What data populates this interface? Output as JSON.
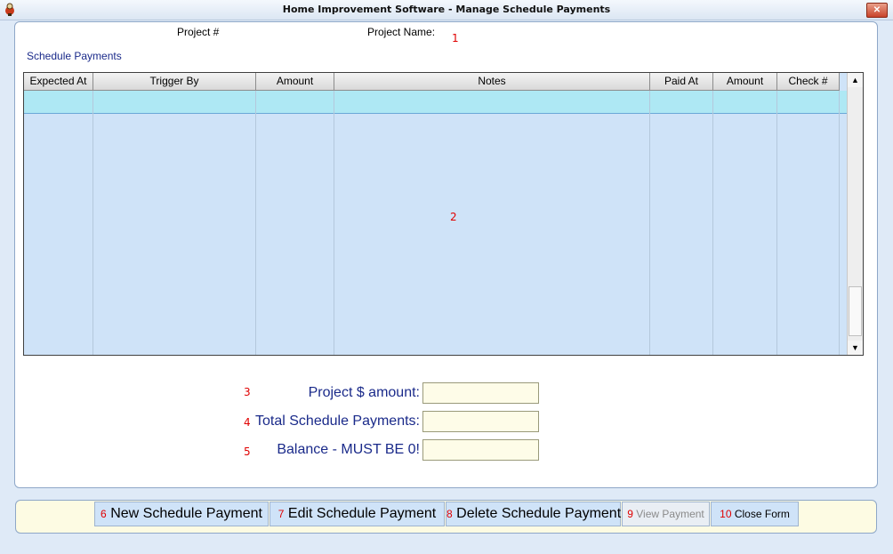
{
  "window": {
    "title": "Home Improvement Software - Manage Schedule Payments",
    "close_label": "✕"
  },
  "header": {
    "project_num_label": "Project #",
    "project_name_label": "Project Name:",
    "marker_1": "1"
  },
  "section_title": "Schedule Payments",
  "grid": {
    "columns": [
      "Expected At",
      "Trigger By",
      "Amount",
      "Notes",
      "Paid At",
      "Amount",
      "Check #"
    ],
    "marker": "2",
    "rows": []
  },
  "totals": {
    "project_amount": {
      "marker": "3",
      "label": "Project $ amount:",
      "value": ""
    },
    "total_schedule": {
      "marker": "4",
      "label": "Total Schedule Payments:",
      "value": ""
    },
    "balance": {
      "marker": "5",
      "label": "Balance - MUST BE 0!",
      "value": ""
    }
  },
  "buttons": {
    "new": {
      "num": "6",
      "label": "New Schedule Payment"
    },
    "edit": {
      "num": "7",
      "label": "Edit Schedule Payment"
    },
    "delete": {
      "num": "8",
      "label": "Delete Schedule Payment"
    },
    "view": {
      "num": "9",
      "label": "View Payment"
    },
    "close": {
      "num": "10",
      "label": "Close Form"
    }
  }
}
